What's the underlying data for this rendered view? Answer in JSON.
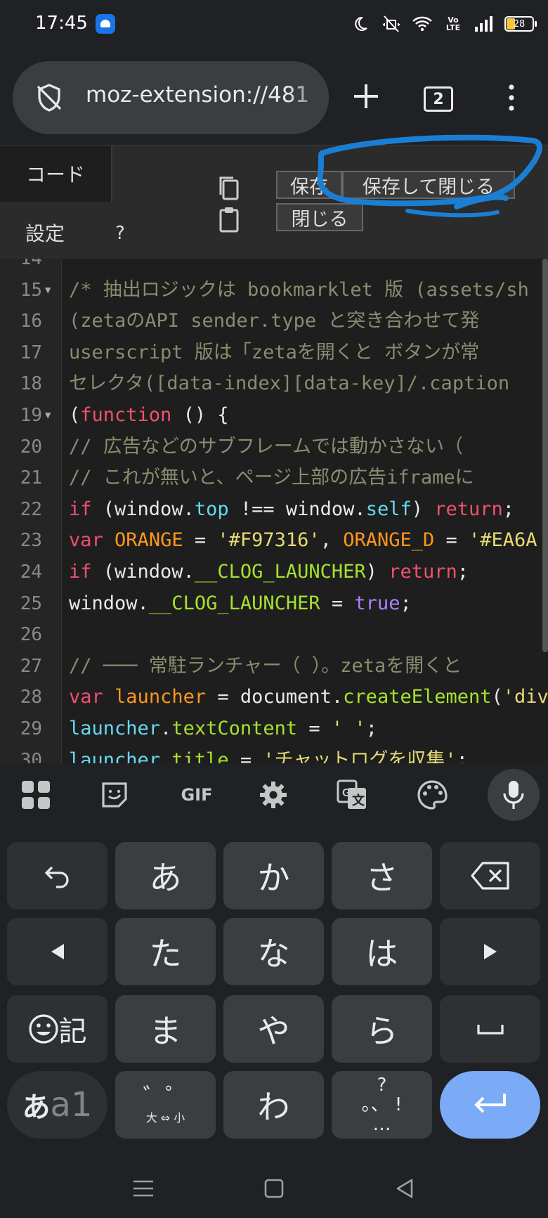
{
  "status_bar": {
    "time": "17:45",
    "volte": "Vo\nLTE",
    "battery": "28"
  },
  "browser": {
    "url": "moz-extension://481",
    "tab_count": "2"
  },
  "editor": {
    "tabs": {
      "code": "コード",
      "settings": "設定",
      "help": "?"
    },
    "buttons": {
      "save": "保存",
      "save_and_close": "保存して閉じる",
      "close": "閉じる"
    },
    "annotation_color": "#1a7fd4"
  },
  "code_lines": [
    {
      "n": "14",
      "fold": false,
      "parts": []
    },
    {
      "n": "15",
      "fold": true,
      "parts": [
        {
          "t": "/* 抽出ロジックは bookmarklet 版 (assets/sh",
          "c": "comment"
        }
      ]
    },
    {
      "n": "16",
      "fold": false,
      "parts": [
        {
          "t": "   (zetaのAPI sender.type と突き合わせて発",
          "c": "comment"
        }
      ]
    },
    {
      "n": "17",
      "fold": false,
      "parts": [
        {
          "t": "  userscript 版は「zetaを開くと ボタンが常",
          "c": "comment"
        }
      ]
    },
    {
      "n": "18",
      "fold": false,
      "parts": [
        {
          "t": "   セレクタ([data-index][data-key]/.caption",
          "c": "comment"
        }
      ]
    },
    {
      "n": "19",
      "fold": true,
      "parts": [
        {
          "t": "(",
          "c": "op"
        },
        {
          "t": "function",
          "c": "kw"
        },
        {
          "t": " () {",
          "c": "op"
        }
      ]
    },
    {
      "n": "20",
      "fold": false,
      "parts": [
        {
          "t": "  // 広告などのサブフレームでは動かさない（",
          "c": "comment"
        }
      ]
    },
    {
      "n": "21",
      "fold": false,
      "parts": [
        {
          "t": "  // これが無いと、ページ上部の広告iframeに",
          "c": "comment"
        }
      ]
    },
    {
      "n": "22",
      "fold": false,
      "parts": [
        {
          "t": "  ",
          "c": "op"
        },
        {
          "t": "if",
          "c": "kw"
        },
        {
          "t": " (window.",
          "c": "op"
        },
        {
          "t": "top",
          "c": "prop"
        },
        {
          "t": " !== window.",
          "c": "op"
        },
        {
          "t": "self",
          "c": "prop"
        },
        {
          "t": ") ",
          "c": "op"
        },
        {
          "t": "return",
          "c": "kw"
        },
        {
          "t": ";",
          "c": "op"
        }
      ]
    },
    {
      "n": "23",
      "fold": false,
      "parts": [
        {
          "t": "  ",
          "c": "op"
        },
        {
          "t": "var",
          "c": "kw"
        },
        {
          "t": " ",
          "c": "op"
        },
        {
          "t": "ORANGE",
          "c": "var"
        },
        {
          "t": " = ",
          "c": "op"
        },
        {
          "t": "'#F97316'",
          "c": "str"
        },
        {
          "t": ", ",
          "c": "op"
        },
        {
          "t": "ORANGE_D",
          "c": "var"
        },
        {
          "t": " = ",
          "c": "op"
        },
        {
          "t": "'#EA6A",
          "c": "str"
        }
      ]
    },
    {
      "n": "24",
      "fold": false,
      "parts": [
        {
          "t": "  ",
          "c": "op"
        },
        {
          "t": "if",
          "c": "kw"
        },
        {
          "t": " (window.",
          "c": "op"
        },
        {
          "t": "__CLOG_LAUNCHER",
          "c": "fn"
        },
        {
          "t": ") ",
          "c": "op"
        },
        {
          "t": "return",
          "c": "kw"
        },
        {
          "t": ";",
          "c": "op"
        }
      ]
    },
    {
      "n": "25",
      "fold": false,
      "parts": [
        {
          "t": "  window.",
          "c": "op"
        },
        {
          "t": "__CLOG_LAUNCHER",
          "c": "fn"
        },
        {
          "t": " = ",
          "c": "op"
        },
        {
          "t": "true",
          "c": "bool"
        },
        {
          "t": ";",
          "c": "op"
        }
      ]
    },
    {
      "n": "26",
      "fold": false,
      "parts": []
    },
    {
      "n": "27",
      "fold": false,
      "parts": [
        {
          "t": "  // ─── 常駐ランチャー（ ）。zetaを開くと",
          "c": "comment"
        }
      ]
    },
    {
      "n": "28",
      "fold": false,
      "parts": [
        {
          "t": "  ",
          "c": "op"
        },
        {
          "t": "var",
          "c": "kw"
        },
        {
          "t": " ",
          "c": "op"
        },
        {
          "t": "launcher",
          "c": "var"
        },
        {
          "t": " = document.",
          "c": "op"
        },
        {
          "t": "createElement",
          "c": "fn"
        },
        {
          "t": "(",
          "c": "op"
        },
        {
          "t": "'div",
          "c": "str"
        }
      ]
    },
    {
      "n": "29",
      "fold": false,
      "parts": [
        {
          "t": "  ",
          "c": "op"
        },
        {
          "t": "launcher",
          "c": "prop"
        },
        {
          "t": ".",
          "c": "op"
        },
        {
          "t": "textContent",
          "c": "fn"
        },
        {
          "t": " = ",
          "c": "op"
        },
        {
          "t": "' '",
          "c": "str"
        },
        {
          "t": ";",
          "c": "op"
        }
      ]
    },
    {
      "n": "30",
      "fold": false,
      "parts": [
        {
          "t": "  ",
          "c": "op"
        },
        {
          "t": "launcher",
          "c": "prop"
        },
        {
          "t": ".",
          "c": "op"
        },
        {
          "t": "title",
          "c": "fn"
        },
        {
          "t": " = ",
          "c": "op"
        },
        {
          "t": "'チャットログを収集'",
          "c": "str"
        },
        {
          "t": ";",
          "c": "op"
        }
      ]
    }
  ],
  "keyboard": {
    "toolbar": {
      "gif": "GIF"
    },
    "keys": {
      "undo": "↶",
      "a": "あ",
      "ka": "か",
      "sa": "さ",
      "left": "◀",
      "ta": "た",
      "na": "な",
      "ha": "は",
      "right": "▶",
      "emoji_label": "記",
      "ma": "ま",
      "ya": "や",
      "ra": "ら",
      "space": "␣",
      "mode_a": "あ",
      "mode_1": "a1",
      "dakuten": "゛゜",
      "dakuten_sub": "大 ⇔ 小",
      "wa": "わ",
      "punct_top": "?",
      "punct_mid": "。、 !",
      "punct_bottom": "…"
    }
  }
}
